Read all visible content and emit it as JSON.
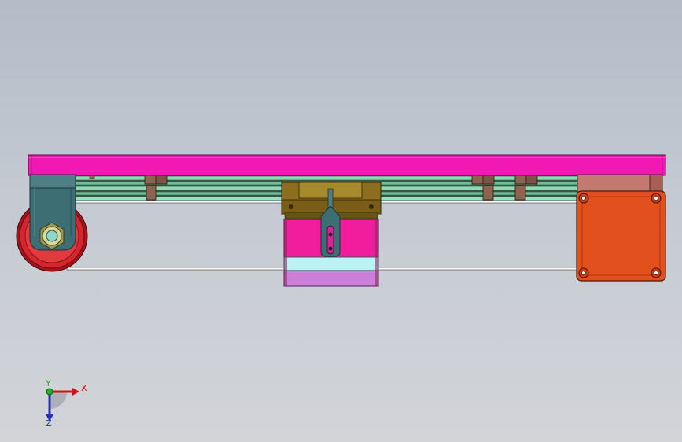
{
  "viewport": {
    "background_top": "#b4bcc8",
    "background_bottom": "#d2d4d8"
  },
  "model": {
    "parts": [
      {
        "name": "top-frame-plate",
        "color": "#f218b4"
      },
      {
        "name": "guide-rails",
        "color": "#6fbf98"
      },
      {
        "name": "idler-pulley",
        "color": "#d3262d"
      },
      {
        "name": "pulley-bracket",
        "color": "#3d6e73"
      },
      {
        "name": "carriage-block",
        "color": "#8c6e1e"
      },
      {
        "name": "carriage-body",
        "color": "#f01e9c"
      },
      {
        "name": "carriage-lower-cyan",
        "color": "#bdf2f4"
      },
      {
        "name": "carriage-lower-violet",
        "color": "#cc7fd9"
      },
      {
        "name": "motor",
        "color": "#e2501e"
      },
      {
        "name": "belt",
        "color": "#ffffff"
      },
      {
        "name": "rail-clamps",
        "color": "#8c6450"
      }
    ]
  },
  "triad": {
    "x_label": "X",
    "y_label": "Y",
    "z_label": "Z",
    "x_color": "#d9101c",
    "y_color": "#17b32a",
    "z_color": "#2430c4"
  }
}
